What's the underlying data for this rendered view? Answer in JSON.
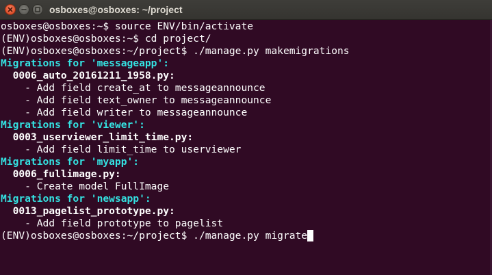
{
  "window": {
    "title": "osboxes@osboxes: ~/project"
  },
  "terminal": {
    "lines": {
      "l0": "osboxes@osboxes:~$ source ENV/bin/activate",
      "l1": "(ENV)osboxes@osboxes:~$ cd project/",
      "l2": "(ENV)osboxes@osboxes:~/project$ ./manage.py makemigrations",
      "l3": "Migrations for 'messageapp':",
      "l4": "  0006_auto_20161211_1958.py:",
      "l5": "    - Add field create_at to messageannounce",
      "l6": "    - Add field text_owner to messageannounce",
      "l7": "    - Add field writer to messageannounce",
      "l8": "Migrations for 'viewer':",
      "l9": "  0003_userviewer_limit_time.py:",
      "l10": "    - Add field limit_time to userviewer",
      "l11": "Migrations for 'myapp':",
      "l12": "  0006_fullimage.py:",
      "l13": "    - Create model FullImage",
      "l14": "Migrations for 'newsapp':",
      "l15": "  0013_pagelist_prototype.py:",
      "l16": "    - Add field prototype to pagelist",
      "l17": "(ENV)osboxes@osboxes:~/project$ ./manage.py migrate"
    }
  },
  "colors": {
    "background": "#300a24",
    "foreground": "#ffffff",
    "heading": "#34e2e2",
    "titlebar": "#3c3b37",
    "close_button": "#e0522d"
  },
  "icons": {
    "close": "close-icon",
    "minimize": "minimize-icon",
    "maximize": "maximize-icon"
  }
}
